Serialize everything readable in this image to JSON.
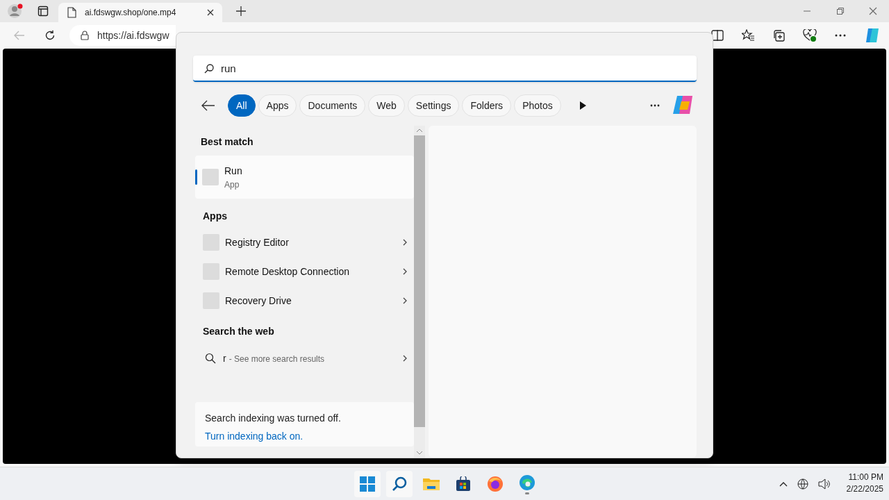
{
  "browser": {
    "tab_title": "ai.fdswgw.shop/one.mp4",
    "address": "https://ai.fdswgw"
  },
  "search": {
    "value": "run",
    "filters": [
      {
        "label": "All",
        "selected": true
      },
      {
        "label": "Apps",
        "selected": false
      },
      {
        "label": "Documents",
        "selected": false
      },
      {
        "label": "Web",
        "selected": false
      },
      {
        "label": "Settings",
        "selected": false
      },
      {
        "label": "Folders",
        "selected": false
      },
      {
        "label": "Photos",
        "selected": false
      }
    ],
    "best_match": {
      "heading": "Best match",
      "name": "Run",
      "type": "App",
      "selected": true
    },
    "apps": {
      "heading": "Apps",
      "items": [
        "Registry Editor",
        "Remote Desktop Connection",
        "Recovery Drive"
      ]
    },
    "web": {
      "heading": "Search the web",
      "query": "r",
      "hint": "- See more search results"
    },
    "notice": {
      "message": "Search indexing was turned off.",
      "link": "Turn indexing back on."
    }
  },
  "clock": {
    "time": "11:00 PM",
    "date": "2/22/2025"
  }
}
